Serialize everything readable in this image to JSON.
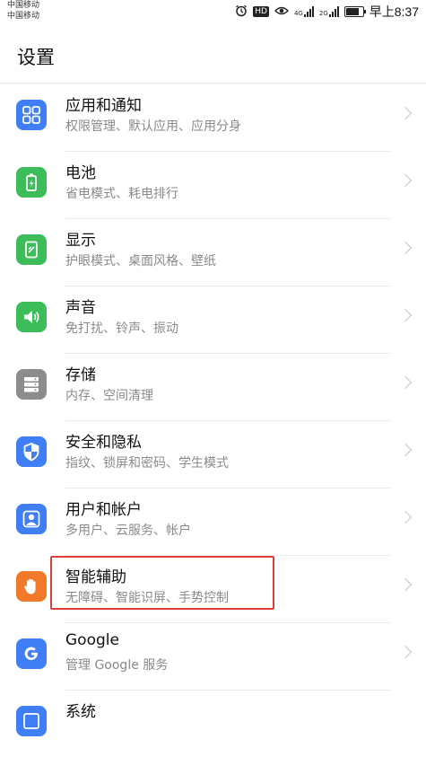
{
  "statusbar": {
    "carrier1": "中国移动",
    "carrier2": "中国移动",
    "hd": "HD",
    "net1": "4G",
    "net2": "2G",
    "time": "早上8:37"
  },
  "header": {
    "title": "设置"
  },
  "colors": {
    "blue": "#3f7ef5",
    "green": "#3dbd5a",
    "gray": "#8c8c8c",
    "orange": "#f07a2a",
    "highlight": "#d8423a"
  },
  "items": [
    {
      "title": "应用和通知",
      "subtitle": "权限管理、默认应用、应用分身",
      "icon": "apps-grid-icon"
    },
    {
      "title": "电池",
      "subtitle": "省电模式、耗电排行",
      "icon": "battery-icon"
    },
    {
      "title": "显示",
      "subtitle": "护眼模式、桌面风格、壁纸",
      "icon": "display-icon"
    },
    {
      "title": "声音",
      "subtitle": "免打扰、铃声、振动",
      "icon": "sound-icon"
    },
    {
      "title": "存储",
      "subtitle": "内存、空间清理",
      "icon": "storage-icon"
    },
    {
      "title": "安全和隐私",
      "subtitle": "指纹、锁屏和密码、学生模式",
      "icon": "shield-icon"
    },
    {
      "title": "用户和帐户",
      "subtitle": "多用户、云服务、帐户",
      "icon": "user-icon"
    },
    {
      "title": "智能辅助",
      "subtitle": "无障碍、智能识屏、手势控制",
      "icon": "hand-icon"
    },
    {
      "title": "Google",
      "subtitle": "管理 Google 服务",
      "icon": "google-icon"
    },
    {
      "title": "系统",
      "subtitle": "",
      "icon": "system-icon"
    }
  ]
}
